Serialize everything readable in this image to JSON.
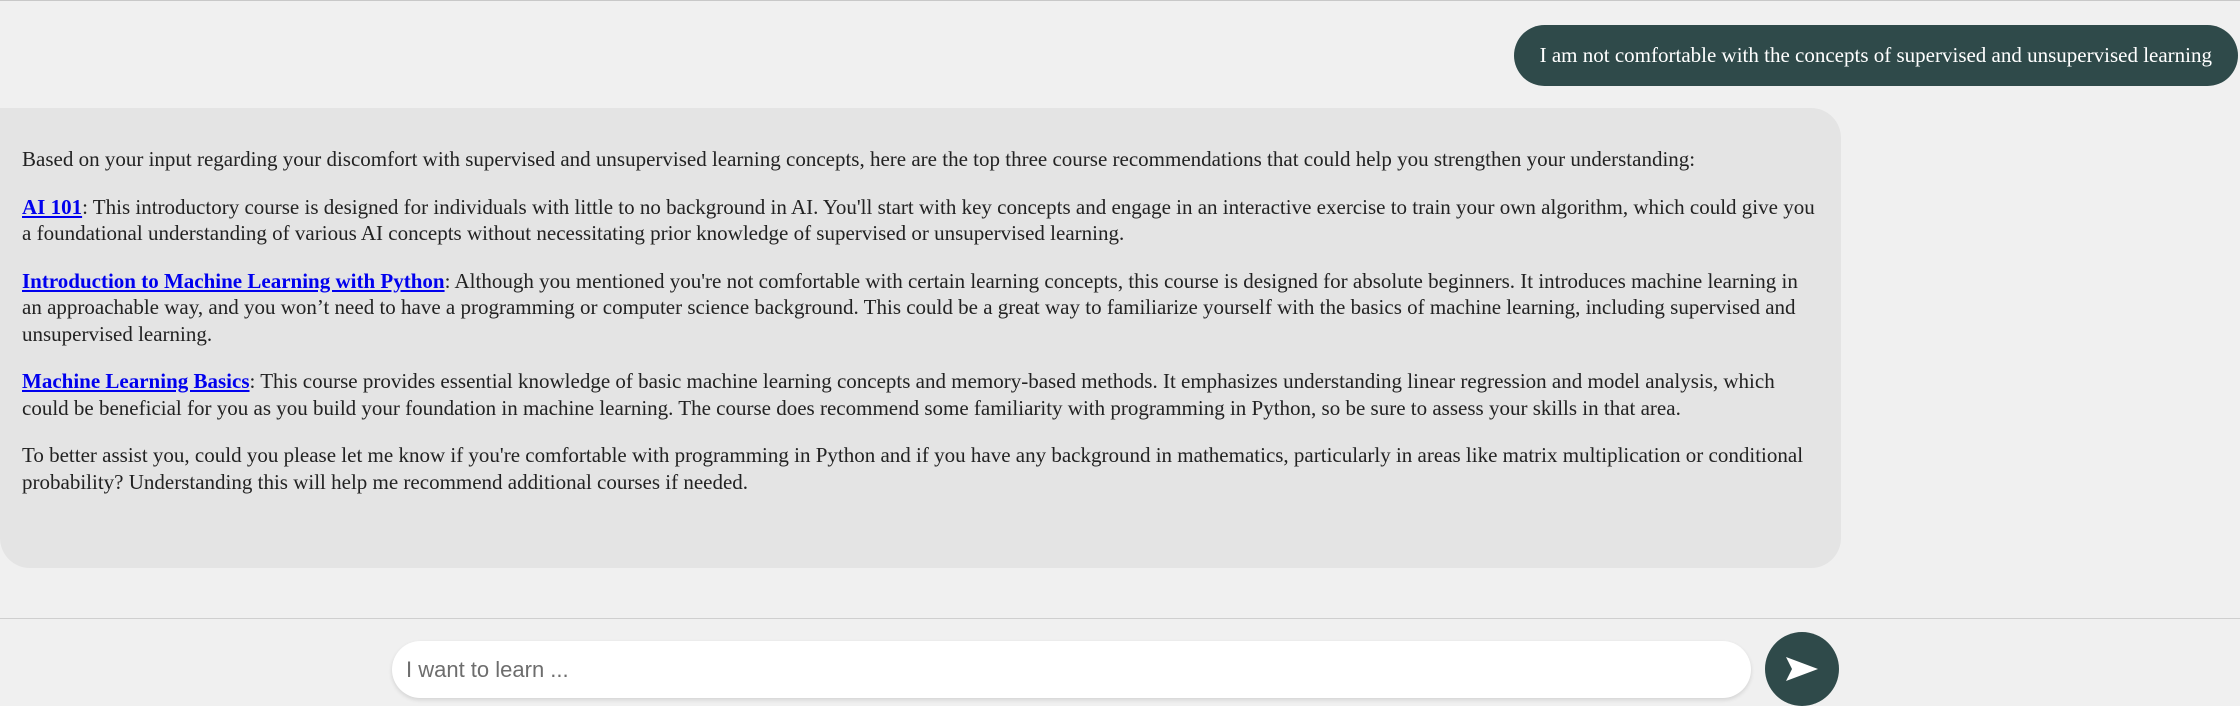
{
  "conversation": {
    "user_message": "I am not comfortable with the concepts of supervised and unsupervised learning",
    "bot": {
      "intro": "Based on your input regarding your discomfort with supervised and unsupervised learning concepts, here are the top three course recommendations that could help you strengthen your understanding:",
      "courses": [
        {
          "title": "AI 101",
          "description": ": This introductory course is designed for individuals with little to no background in AI. You'll start with key concepts and engage in an interactive exercise to train your own algorithm, which could give you a foundational understanding of various AI concepts without necessitating prior knowledge of supervised or unsupervised learning."
        },
        {
          "title": "Introduction to Machine Learning with Python",
          "description": ": Although you mentioned you're not comfortable with certain learning concepts, this course is designed for absolute beginners. It introduces machine learning in an approachable way, and you won’t need to have a programming or computer science background. This could be a great way to familiarize yourself with the basics of machine learning, including supervised and unsupervised learning."
        },
        {
          "title": "Machine Learning Basics",
          "description": ": This course provides essential knowledge of basic machine learning concepts and memory-based methods. It emphasizes understanding linear regression and model analysis, which could be beneficial for you as you build your foundation in machine learning. The course does recommend some familiarity with programming in Python, so be sure to assess your skills in that area."
        }
      ],
      "closing": "To better assist you, could you please let me know if you're comfortable with programming in Python and if you have any background in mathematics, particularly in areas like matrix multiplication or conditional probability? Understanding this will help me recommend additional courses if needed."
    }
  },
  "composer": {
    "placeholder": "I want to learn ...",
    "value": "",
    "send_icon": "send-arrow-icon"
  },
  "colors": {
    "page_background": "#f0f0f0",
    "user_bubble": "#2f4a4a",
    "bot_bubble": "#e4e4e4",
    "link": "#0000ee",
    "send_button": "#2f4a4a"
  }
}
